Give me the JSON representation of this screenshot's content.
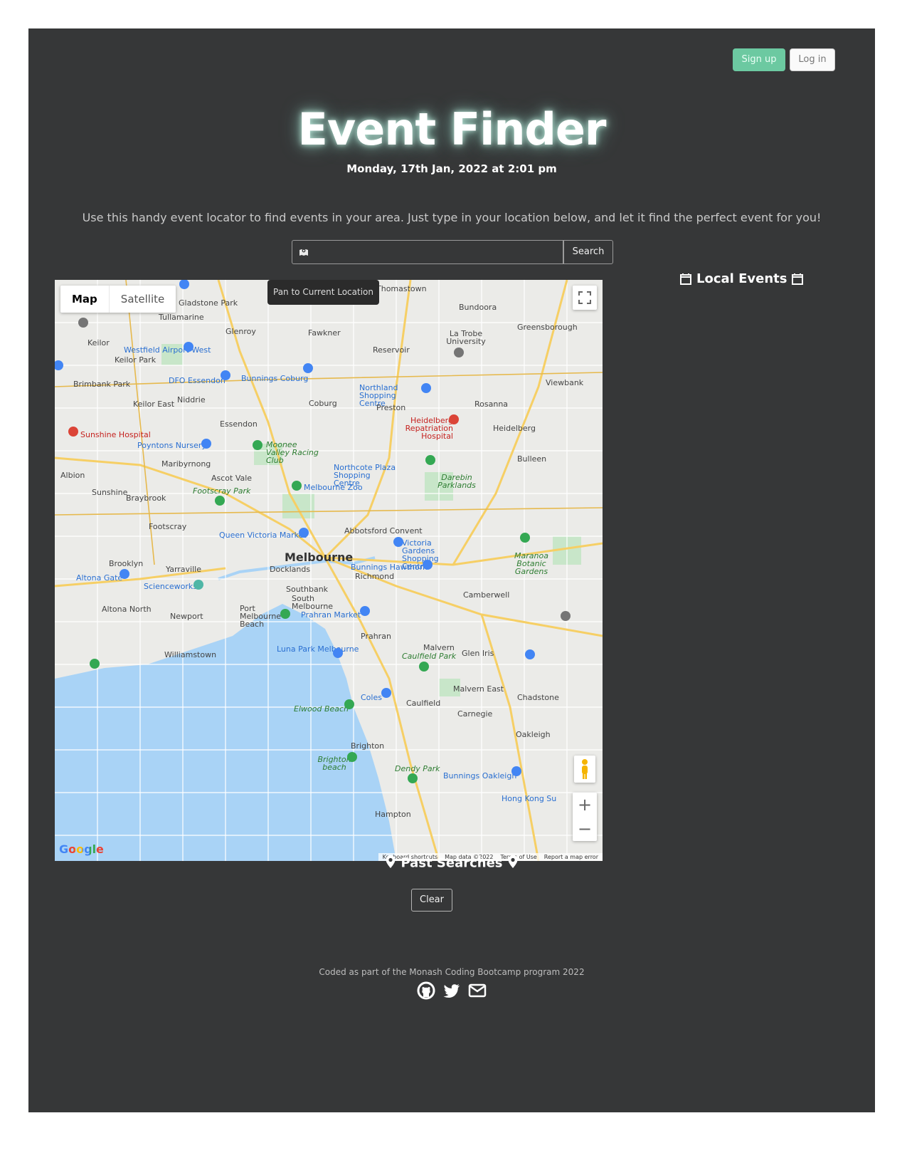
{
  "header": {
    "signup_label": "Sign up",
    "login_label": "Log in",
    "title": "Event Finder",
    "datetime": "Monday, 17th Jan, 2022 at 2:01 pm",
    "intro": "Use this handy event locator to find events in your area. Just type in your location below, and let it find the perfect event for you!"
  },
  "search": {
    "value": "",
    "button_label": "Search"
  },
  "local_events": {
    "heading": "Local Events"
  },
  "map": {
    "type_map": "Map",
    "type_satellite": "Satellite",
    "pan_tooltip": "Pan to Current Location",
    "google": "Google",
    "attribution": [
      "Keyboard shortcuts",
      "Map data ©2022",
      "Terms of Use",
      "Report a map error"
    ],
    "labels": {
      "melbourne": "Melbourne",
      "docklands": "Docklands",
      "richmond": "Richmond",
      "southbank": "Southbank",
      "south_melbourne": "South Melbourne",
      "port_melbourne_beach": "Port Melbourne Beach",
      "prahran": "Prahran",
      "prahran_market": "Prahran Market",
      "queen_victoria_market": "Queen Victoria Market",
      "abbotsford_convent": "Abbotsford Convent",
      "victoria_gardens": "Victoria Gardens Shopping Centre",
      "bunnings_hawthorn": "Bunnings Hawthorn",
      "melbourne_zoo": "Melbourne Zoo",
      "northcote_plaza": "Northcote Plaza Shopping Centre",
      "northland": "Northland Shopping Centre",
      "preston": "Preston",
      "coburg": "Coburg",
      "bunnings_coburg": "Bunnings Coburg",
      "essendon": "Essendon",
      "dfo_essendon": "DFO Essendon",
      "moonee_valley": "Moonee Valley Racing Club",
      "poyntons": "Poyntons Nursery",
      "sunshine_hospital": "Sunshine Hospital",
      "westfield_airport": "Westfield Airport West",
      "heidelberg": "Heidelberg",
      "heidelberg_hospital": "Heidelberg Repatriation Hospital",
      "la_trobe": "La Trobe University",
      "bundoora": "Bundoora",
      "reservoir": "Reservoir",
      "greensborough": "Greensborough",
      "viewbank": "Viewbank",
      "rosanna": "Rosanna",
      "bulleen": "Bulleen",
      "darebin_parklands": "Darebin Parklands",
      "maranoa": "Maranoa Botanic Gardens",
      "camberwell": "Camberwell",
      "malvern": "Malvern",
      "caulfield_park": "Caulfield Park",
      "glen_iris": "Glen Iris",
      "malvern_east": "Malvern East",
      "caulfield": "Caulfield",
      "carnegie": "Carnegie",
      "chadstone": "Chadstone",
      "coles": "Coles",
      "elwood_beach": "Elwood Beach",
      "luna_park": "Luna Park Melbourne",
      "brighton": "Brighton",
      "brighton_beach": "Brighton beach",
      "dendy_park": "Dendy Park",
      "bunnings_oakleigh": "Bunnings Oakleigh",
      "oakleigh": "Oakleigh",
      "hampton": "Hampton",
      "williamstown": "Williamstown",
      "newport": "Newport",
      "altona_north": "Altona North",
      "altona_gate": "Altona Gate",
      "brooklyn": "Brooklyn",
      "yarraville": "Yarraville",
      "scienceworks": "Scienceworks",
      "footscray": "Footscray",
      "footscray_park": "Footscray Park",
      "maribyrnong": "Maribyrnong",
      "ascot_vale": "Ascot Vale",
      "braybrook": "Braybrook",
      "sunshine": "Sunshine",
      "albion": "Albion",
      "keilor_east": "Keilor East",
      "keilor_park": "Keilor Park",
      "keilor": "Keilor",
      "niddrie": "Niddrie",
      "glenroy": "Glenroy",
      "fawkner": "Fawkner",
      "tullamarine": "Tullamarine",
      "gladstone_park": "Gladstone Park",
      "thomastown": "Thomastown",
      "brimbank_park": "Brimbank Park",
      "hong_kong": "Hong Kong Su"
    }
  },
  "past_searches": {
    "heading": "Past Searches",
    "clear_label": "Clear"
  },
  "footer": {
    "text": "Coded as part of the Monash Coding Bootcamp program 2022"
  }
}
